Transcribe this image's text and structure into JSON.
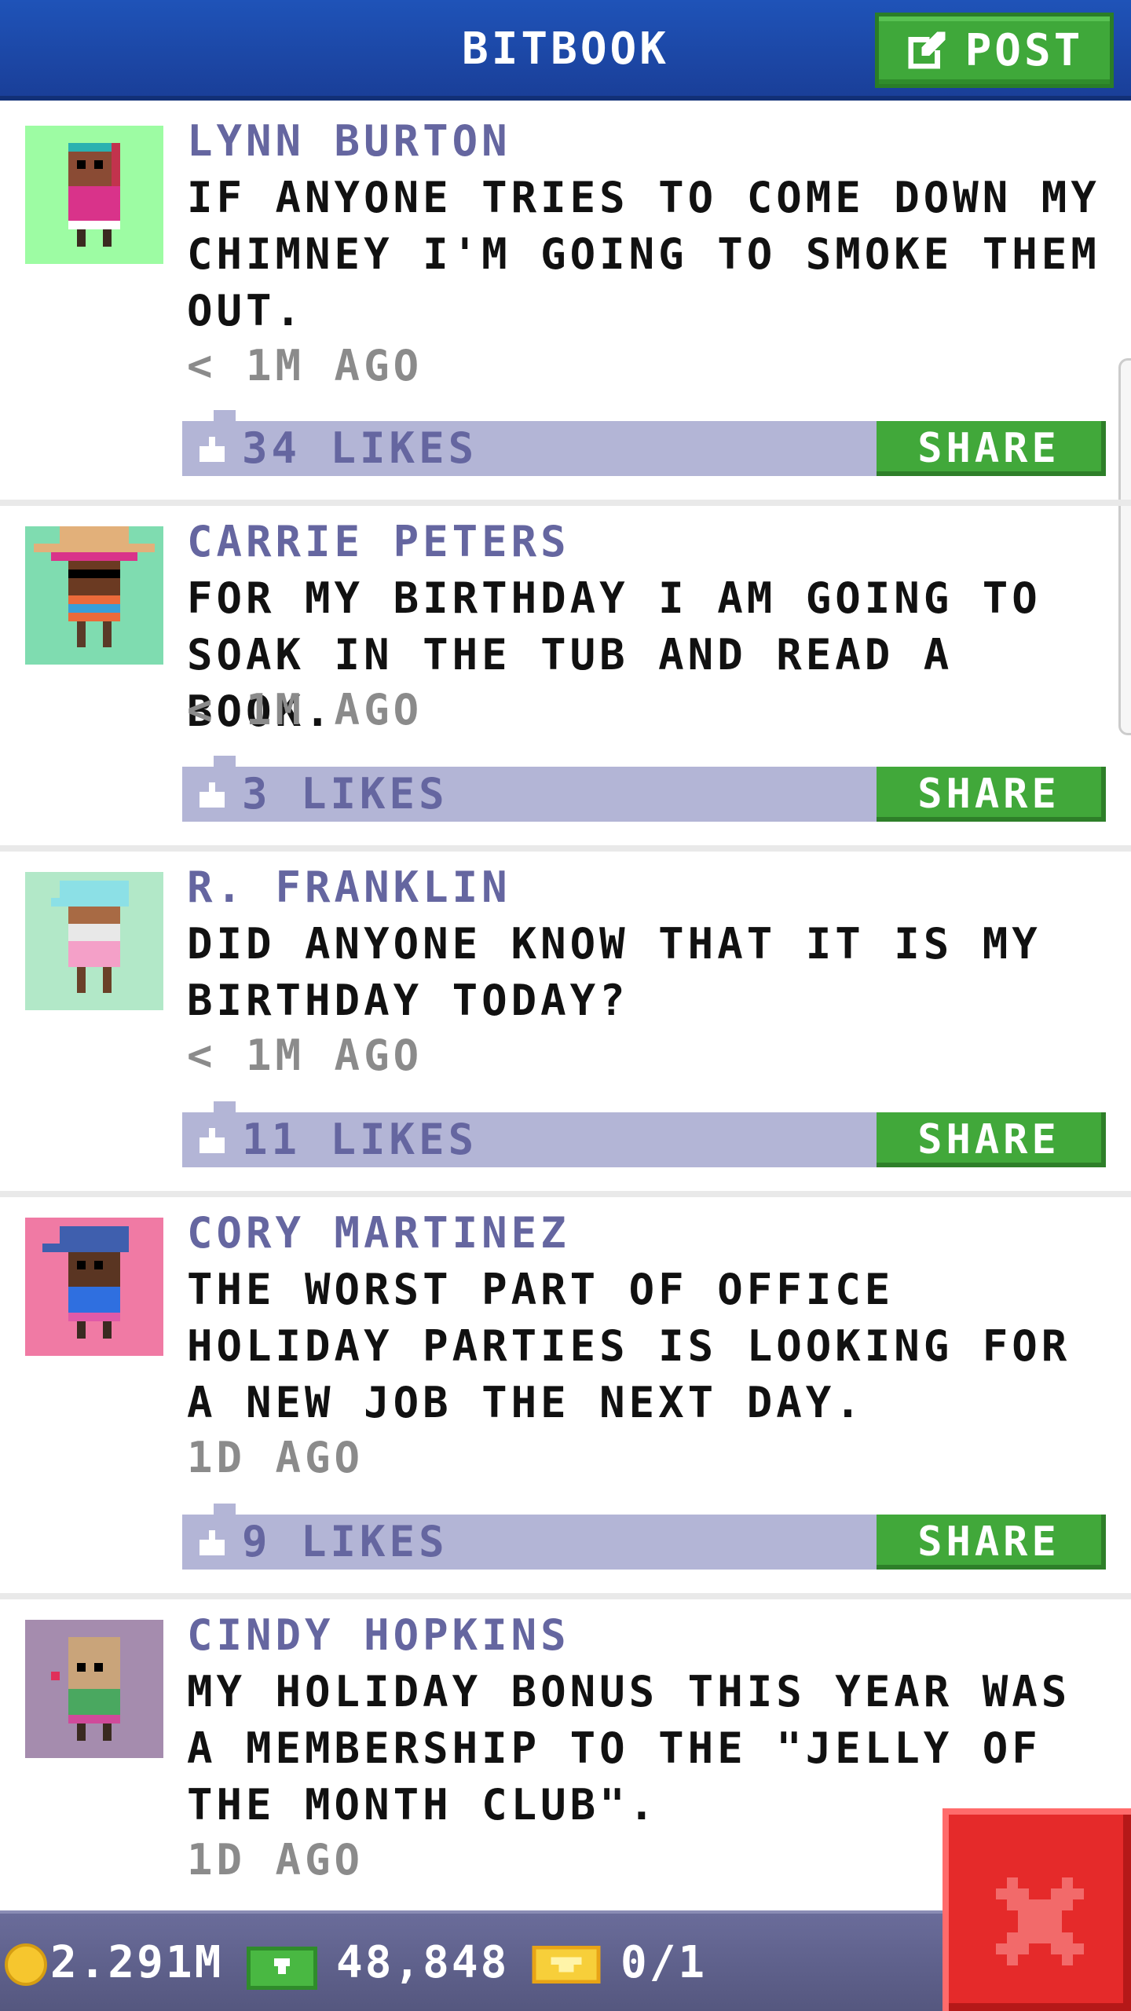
{
  "header": {
    "title": "BITBOOK",
    "post_label": "POST"
  },
  "posts": [
    {
      "author": "LYNN BURTON",
      "text": "IF ANYONE TRIES TO COME DOWN MY CHIMNEY I'M GOING TO SMOKE THEM OUT.",
      "time": "< 1M AGO",
      "likes": "34 LIKES",
      "share": "SHARE",
      "avatar_bg": "#9dfca3"
    },
    {
      "author": "CARRIE PETERS",
      "text": "FOR MY BIRTHDAY I AM GOING TO SOAK IN THE TUB AND READ A BOOK.",
      "time": "< 1M AGO",
      "likes": "3 LIKES",
      "share": "SHARE",
      "avatar_bg": "#7fdcb0"
    },
    {
      "author": "R. FRANKLIN",
      "text": "DID ANYONE KNOW THAT IT IS MY BIRTHDAY TODAY?",
      "time": "< 1M AGO",
      "likes": "11 LIKES",
      "share": "SHARE",
      "avatar_bg": "#b2e8c8"
    },
    {
      "author": "CORY MARTINEZ",
      "text": "THE WORST PART OF OFFICE HOLIDAY PARTIES IS LOOKING FOR A NEW JOB THE NEXT DAY.",
      "time": "1D AGO",
      "likes": "9 LIKES",
      "share": "SHARE",
      "avatar_bg": "#f07aa4"
    },
    {
      "author": "CINDY HOPKINS",
      "text": "MY HOLIDAY BONUS THIS YEAR WAS A MEMBERSHIP TO THE \"JELLY OF THE MONTH CLUB\".",
      "time": "1D AGO",
      "likes": "",
      "share": "",
      "avatar_bg": "#a58cae"
    }
  ],
  "bottom_bar": {
    "coins": "2.291M",
    "bux": "48,848",
    "tickets": "0/1"
  },
  "icons": {
    "post": "edit-icon",
    "like": "thumbs-up-icon",
    "coin": "coin-icon",
    "bux": "cash-icon",
    "ticket": "ticket-icon",
    "close": "close-icon"
  },
  "colors": {
    "header_bg": "#1f53b8",
    "accent_green": "#41a83a",
    "likes_bar": "#b3b5d6",
    "author_text": "#6566a0",
    "close_red": "#e52a2a"
  }
}
